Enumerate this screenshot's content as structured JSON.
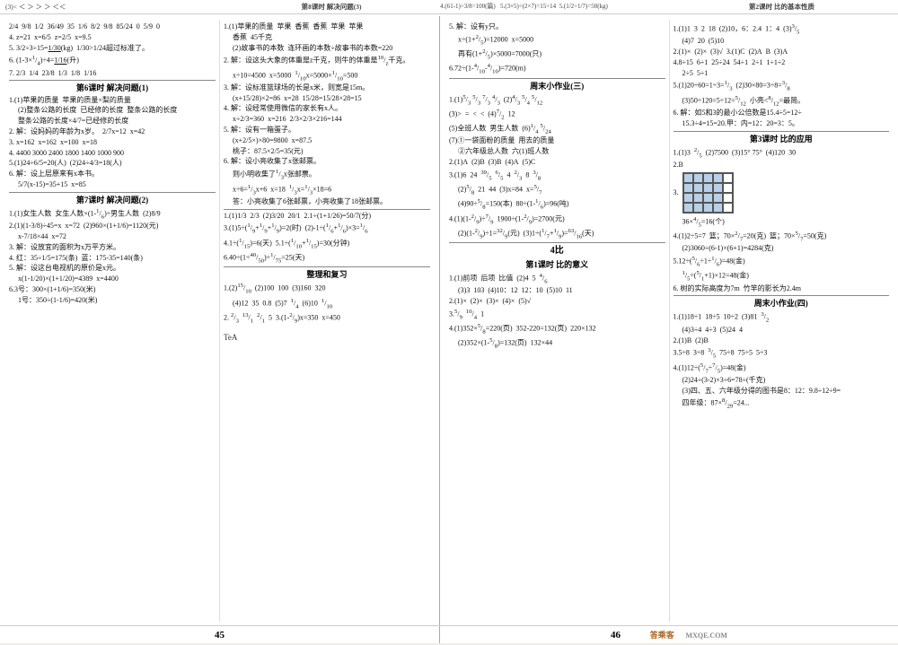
{
  "page": {
    "left_page_num": "45",
    "right_page_num": "46",
    "watermark": "答乘客"
  },
  "left_col1": {
    "header": "(3)< ＜ ＞ ＞ ＞ ＜＜",
    "lines": [
      "2/4  9/8  1/2  36/49  35  1/6  8/2  9/8  85/24  0  5/9  0",
      "4. z=21  x=6/5  z=2/5  x=9.5",
      "5. 3/2÷3÷15=1/30(kg)  1/30>1/24超过标准了。",
      "6. (1-3×1/4)÷4=1/16(升)",
      "7. 2/3  1/4  23/8  1/3  1/8  1/16",
      "第6课时 解决问题(1)",
      "1.(1)苹果的质量  苹果的质量×梨的质量",
      "  (2)整条公路的长度  已经修的长度  整条公路的长度",
      "  整条公路的长度×4/7=已经修的长度",
      "2. 解：设妈妈的年龄为x岁。  2/7x=12  x=42",
      "3. x=162  x=162  x=100  x=18",
      "4. 4400  3000  2400  1800  1400  1000  900",
      "5.(1)24÷6/5=20(人)  (2)24÷4/3=18(人)",
      "6. 解：设上层原来有x本书。",
      "  5/7(x-15)=35+15  x=85",
      "第7课时 解决问题(2)",
      "1.(1)女生人数  女生人数×(1-1/6÷男生人数  (2)8/9",
      "2.(1)(1-3/8)÷45=x  x=72  (2)960×(1+1/6)=1120(元)",
      "  x-7/18×44  x=72",
      "3. 解：设放宜的面积为x万平方米。",
      "  4. 红：35÷1/5=175(条)  蓝：175-35=140(条)",
      "5. 解：设这台电视机的原价是x元。",
      "  x(1-1/20)×(1+1/20)=4389  x=4400",
      "6.3号：300×(1+1/6)=350(米)",
      "  1号：350÷(1-1/6)=420(米)"
    ]
  },
  "left_col2": {
    "header": "第8课时 解决问题(3)",
    "lines": [
      "1.(1)苹果的质量  苹果  香蕉  香蕉  苹果  苹果",
      "  香蕉  45千克",
      "  (2)故事书的本数  连环画的本数÷故事书的本数=220",
      "2. 解：设这头大象的体重是z千克，则牛的体重是10/z千克。",
      "  x÷10=4500  x=5000  1/10 x=5000×1/10=500",
      "3. 解：设标准篮球场的长是x米，则宽是15米。",
      "  (x+15/28)×2=86  x=28  15/28=15/28×28=15",
      "4. 解：设经常使用微信的家长有x人。",
      "  x÷2/3×=360  x=216  2/3×2/3×216=144",
      "5. 解：设有一箱蛋子。",
      "  (x+2/5×)×80=9800  x=87.5",
      "  桃子：87.5×2/5=35(元)",
      "6. 解：设小亮收集了x张邮票。",
      "  则小明收集了1/3x张邮票。",
      "  x÷6=1/3x+6  x=18  1/3x=1/3×18=6",
      "  答：小亮收集了6张邮票，小亮收集了18张邮票。",
      "1.(1)1/3  2/3  (2)3/20  20/1  2.1÷(1+1/26)=50/7(分)",
      "3.(1)5÷(1/9+1/9+1/9)=2(时)  (2)-1÷(1/6+1/6)×3=1/6",
      "4.1÷(1/15)=6(天)  5.1÷(1/10+1/15)=30(分钟)",
      "6.40÷(1÷40/50)÷1/75=25(天)",
      "整理和复习",
      "1.(2)15/10  (2)100  100  (3)160  320",
      "  (4)12  35  0.8  (5)7  1/4  (6)10  1/10",
      "2. 2/3  13  2/1  5  3.(1-2/9)x=350  x=450"
    ]
  },
  "right_col1": {
    "header": "5. 解：设有y只。",
    "lines": [
      "x÷(1+2/5)=12000  x=5000",
      "再有(1+2/5)×5000=7000(只)",
      "6.72÷(1-4/10-4/10)=720(m)",
      "周末小作业(三)",
      "1.(1)5/3  5/3  7/3  4/3  (2)4/3  5/4  5/12",
      "(3)> = < <  (4)7/2  12",
      "(5)全班人数  男生人数  (6)1/4  5/24",
      "(7)①一袋面粉的质量  用去的质量",
      "  ②六年级总人数  六(1)班人数",
      "2.(1)A  (2)B  (3)B  (4)A  (5)C",
      "3.(1)6  24  39/5  6/5  4  2/3  8  3/8",
      "  (2)5/8  21  44  (3)x=84  x=5/7",
      "  (4)90÷5/8=150(本)  80÷(1-1/6)=96(吨)",
      "4.(1)(1-2/9)÷7/9  1900÷(1-2/9)=2700(元)",
      "  (2)(1-2/9)÷1=32/9(元)  (3)1÷(1/7+1/9)=63/16(天)",
      "4比",
      "第1课时 比的意义",
      "1.(1)前项  后项  比值  (2)4  5  4/6",
      "  (3)3  103  (4)10：12  12：10  (5)10  11",
      "2.(1)×  (2)×  (3)×  (4)×  (5)√",
      "3.5/9  10/4  1",
      "4.(1)352×5/8=220(页)  352-220=132(页)  220×132",
      "  (2)352×(1-5/8)=132(页)  132×44"
    ]
  },
  "right_col2": {
    "header": "第2课时 比的基本性质",
    "lines": [
      "1.(1)1  3  2  18  (2)10，6：2.4  1：4  (3)3/5",
      "  (4)7  20  (5)10",
      "2.(1)×  (2)×  (3)√  (3).(1)C  (2)A  B  (3)A",
      "4.8÷15  6÷1  25÷24  54÷1  2÷1  1÷1÷2",
      "  2÷5  5÷1",
      "5.(1)20÷60=1÷3=1/3  (2)30×80=3÷8=3/8",
      "  (3)50÷120=5÷12=5/12  小亮<8/12=最简。",
      "6. 解：如5和3的最小公倍数是15.4÷5=12÷",
      "  15.3÷4=15=20.甲：内=12：20=3：5。",
      "第3课时 比的应用",
      "1.(1)3  2/5  (2)7500  (3)15° 75°  (4)120  30",
      "2.B",
      "3. [grid]",
      "  36×4/5=16(个)",
      "4.(1)2÷5=7  篮；70×2/7=20(克)  篮；70×5/7=50(克)",
      "  (2)3060÷(6-1)×(6+1)=4284(克)",
      "5.12÷(5/6÷1÷1/6)=48(金)",
      "  1/5÷(5/1+1)×12=48(金)",
      "6. 树的实际高度为7m  竹竿的影长为2.4m",
      "周末小作业(四)",
      "1.(1)18÷1  18÷5  10÷2  (3)81  3/2",
      "  (4)3÷4  4÷3  (5)24  4",
      "2.(1)B  (2)B",
      "3.5÷8  3÷8  3/5  75÷8  75÷5  5÷3",
      "4.(1)12÷(5/7÷7/5)=48(金)",
      "  (2)24÷(3-2)×3÷6=78÷(千克)",
      "  (3)四、五、六年级分得的图书是8：12：9.8÷12÷9=",
      "  四年级：87×8/29=24..."
    ]
  },
  "top_row": {
    "left": "(3)< ＜ ＞ ＞ ＞ ＜＜",
    "col2_header": "第8课时 解决问题(3)",
    "col3_part": "4.(61-1)÷3/8=100(篇)",
    "col3_part2": "5.(3×5)÷(2×7)=15÷14  5.(1/2÷1/7)=50(kg)"
  }
}
